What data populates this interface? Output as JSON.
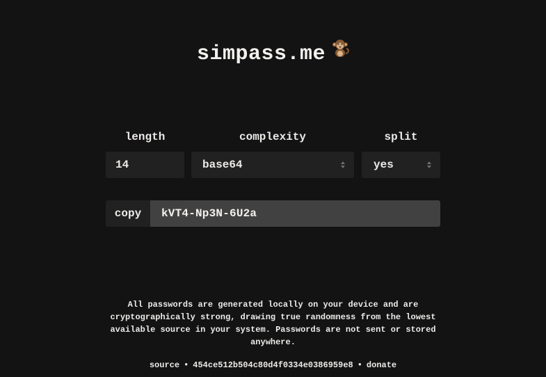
{
  "header": {
    "title": "simpass.me",
    "icon": "monkey-icon"
  },
  "controls": {
    "length": {
      "label": "length",
      "value": "14"
    },
    "complexity": {
      "label": "complexity",
      "value": "base64"
    },
    "split": {
      "label": "split",
      "value": "yes"
    }
  },
  "output": {
    "copy_label": "copy",
    "password": "kVT4-Np3N-6U2a"
  },
  "info_text": "All passwords are generated locally on your device and are cryptographically strong, drawing true randomness from the lowest available source in your system. Passwords are not sent or stored anywhere.",
  "footer": {
    "source_label": "source",
    "separator": "•",
    "commit_hash": "454ce512b504c80d4f0334e0386959e8",
    "donate_label": "donate"
  },
  "colors": {
    "background": "#141314",
    "field": "#222122",
    "password_field": "#424142",
    "text": "#ecebe8"
  }
}
